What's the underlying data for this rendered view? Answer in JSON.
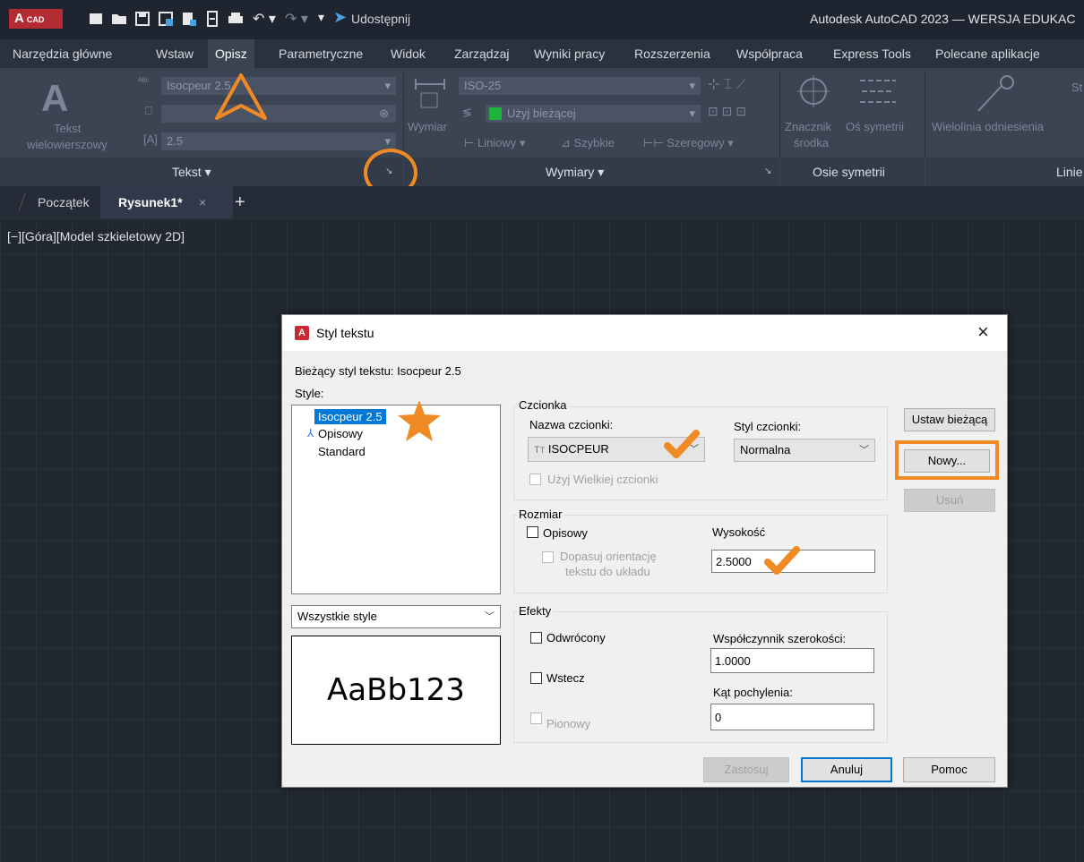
{
  "titlebar": {
    "logo_a": "A",
    "logo_cad": "CAD",
    "share": "Udostępnij",
    "title": "Autodesk AutoCAD 2023 — WERSJA EDUKAC"
  },
  "ribbon_tabs": [
    "Narzędzia główne",
    "Wstaw",
    "Opisz",
    "Parametryczne",
    "Widok",
    "Zarządzaj",
    "Wyniki pracy",
    "Rozszerzenia",
    "Współpraca",
    "Express Tools",
    "Polecane aplikacje"
  ],
  "ribbon": {
    "text_tool_line1": "Tekst",
    "text_tool_line2": "wielowierszowy",
    "text_style_value": "Isocpeur 2.5",
    "text_height_value": "2.5",
    "panel_text": "Tekst ▾",
    "dim_tool": "Wymiar",
    "dim_style_value": "ISO-25",
    "layer_value": "Użyj bieżącej",
    "linear": "Liniowy",
    "quick": "Szybkie",
    "continuous": "Szeregowy",
    "panel_dims": "Wymiary ▾",
    "center_mark_1": "Znacznik",
    "center_mark_2": "środka",
    "centerline": "Oś symetrii",
    "panel_center": "Osie symetrii",
    "leader": "Wielolinia odniesienia",
    "panel_leader": "Linie",
    "style_abbr": "St"
  },
  "doc_tabs": {
    "start": "Początek",
    "drawing": "Rysunek1*",
    "close": "×",
    "add": "+"
  },
  "viewport_label": "[−][Góra][Model szkieletowy 2D]",
  "dialog": {
    "title": "Styl tekstu",
    "close": "×",
    "current_style_label": "Bieżący styl tekstu:",
    "current_style_value": "Isocpeur 2.5",
    "styles_label": "Style:",
    "styles": [
      "Isocpeur 2.5",
      "Opisowy",
      "Standard"
    ],
    "filter_value": "Wszystkie style",
    "preview_text": "AaBb123",
    "font_group": "Czcionka",
    "font_name_label": "Nazwa czcionki:",
    "font_name_value": "ISOCPEUR",
    "font_style_label": "Styl czcionki:",
    "font_style_value": "Normalna",
    "big_font_label": "Użyj Wielkiej czcionki",
    "size_group": "Rozmiar",
    "annotative_label": "Opisowy",
    "match_orientation_line1": "Dopasuj orientację",
    "match_orientation_line2": "tekstu do układu",
    "height_label": "Wysokość",
    "height_value": "2.5000",
    "effects_group": "Efekty",
    "upside_down_label": "Odwrócony",
    "backwards_label": "Wstecz",
    "vertical_label": "Pionowy",
    "width_factor_label": "Współczynnik szerokości:",
    "width_factor_value": "1.0000",
    "oblique_label": "Kąt pochylenia:",
    "oblique_value": "0",
    "btn_set_current": "Ustaw bieżącą",
    "btn_new": "Nowy...",
    "btn_delete": "Usuń",
    "btn_apply": "Zastosuj",
    "btn_cancel": "Anuluj",
    "btn_help": "Pomoc"
  },
  "colors": {
    "accent_orange": "#f08a24",
    "selection_blue": "#0078d7",
    "autocad_red": "#b52b34"
  }
}
